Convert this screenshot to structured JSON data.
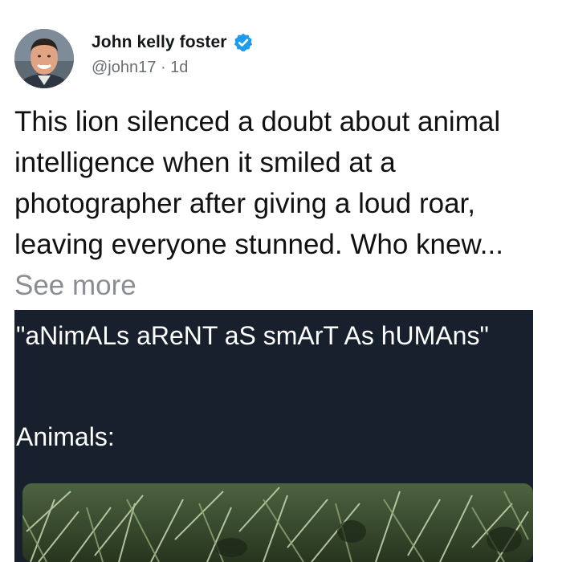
{
  "author": {
    "name": "John kelly foster",
    "handle": "@john17",
    "separator": "·",
    "time": "1d",
    "verified": true
  },
  "tweet": {
    "text": "This lion silenced a doubt about animal intelligence when it smiled at a photographer after giving a loud roar, leaving everyone stunned. Who knew...",
    "see_more": "See more"
  },
  "card": {
    "quote": "\"aNimALs aReNT aS smArT As hUMAns\"",
    "label": "Animals:"
  },
  "colors": {
    "verified_badge": "#1d9bf0",
    "card_background": "#17202c",
    "handle_text": "#6a6f74",
    "see_more_text": "#8a8d91"
  },
  "icons": {
    "verified": "verified-badge-icon",
    "avatar": "user-avatar"
  }
}
